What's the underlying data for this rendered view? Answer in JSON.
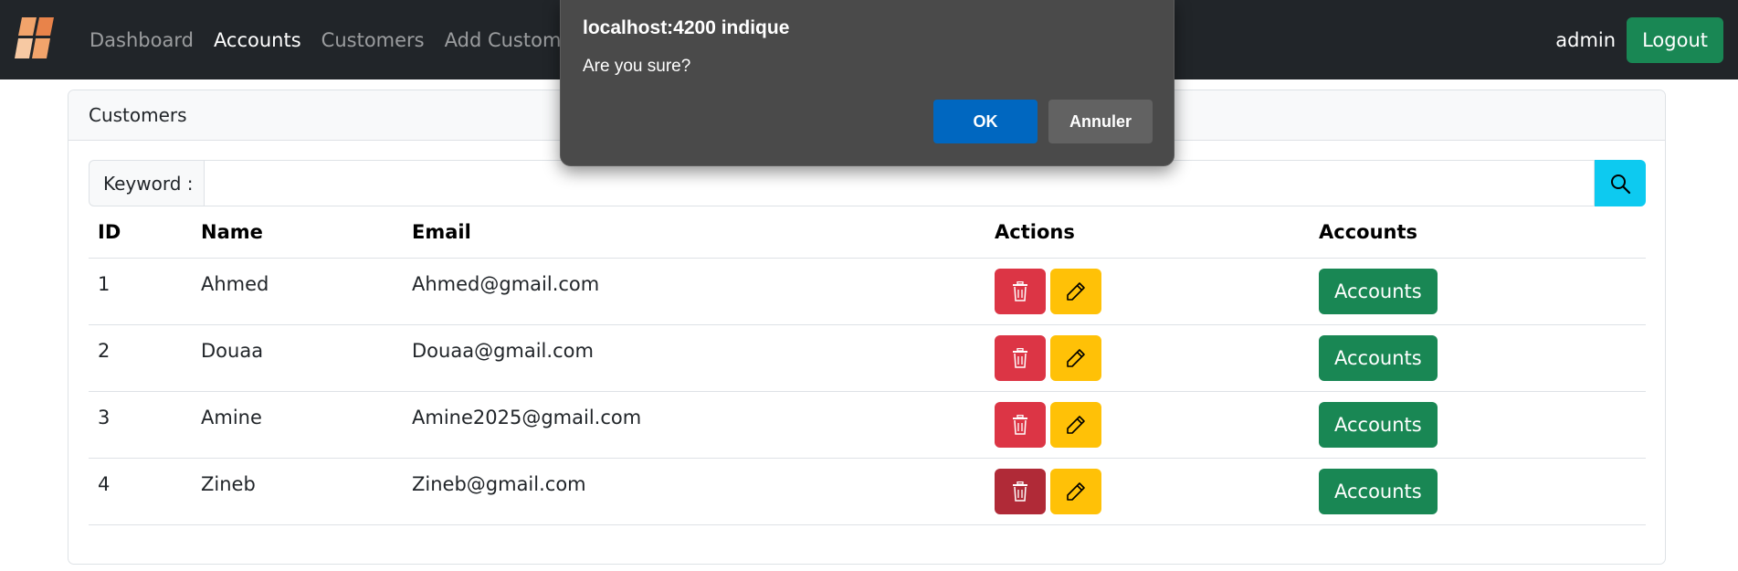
{
  "navbar": {
    "logo_icon": "stacked-tiles-logo-icon",
    "links": [
      {
        "label": "Dashboard",
        "active": false
      },
      {
        "label": "Accounts",
        "active": true
      },
      {
        "label": "Customers",
        "active": false
      },
      {
        "label": "Add Customer",
        "active": false
      }
    ],
    "username": "admin",
    "logout_label": "Logout"
  },
  "card": {
    "title": "Customers",
    "search": {
      "label": "Keyword :",
      "value": "",
      "placeholder": "",
      "icon": "search-icon"
    },
    "table": {
      "headers": [
        "ID",
        "Name",
        "Email",
        "Actions",
        "Accounts"
      ],
      "rows": [
        {
          "id": "1",
          "name": "Ahmed",
          "email": "Ahmed@gmail.com",
          "accounts_label": "Accounts"
        },
        {
          "id": "2",
          "name": "Douaa",
          "email": "Douaa@gmail.com",
          "accounts_label": "Accounts"
        },
        {
          "id": "3",
          "name": "Amine",
          "email": "Amine2025@gmail.com",
          "accounts_label": "Accounts"
        },
        {
          "id": "4",
          "name": "Zineb",
          "email": "Zineb@gmail.com",
          "accounts_label": "Accounts"
        }
      ],
      "delete_icon": "trash-icon",
      "edit_icon": "pencil-icon"
    }
  },
  "dialog": {
    "title": "localhost:4200 indique",
    "message": "Are you sure?",
    "ok_label": "OK",
    "cancel_label": "Annuler"
  },
  "colors": {
    "navbar": "#212529",
    "danger": "#dc3545",
    "warning": "#ffc107",
    "success": "#198754",
    "info": "#0dcaf0",
    "dialog_bg": "#4a4a4a",
    "dialog_primary": "#0067c0"
  }
}
